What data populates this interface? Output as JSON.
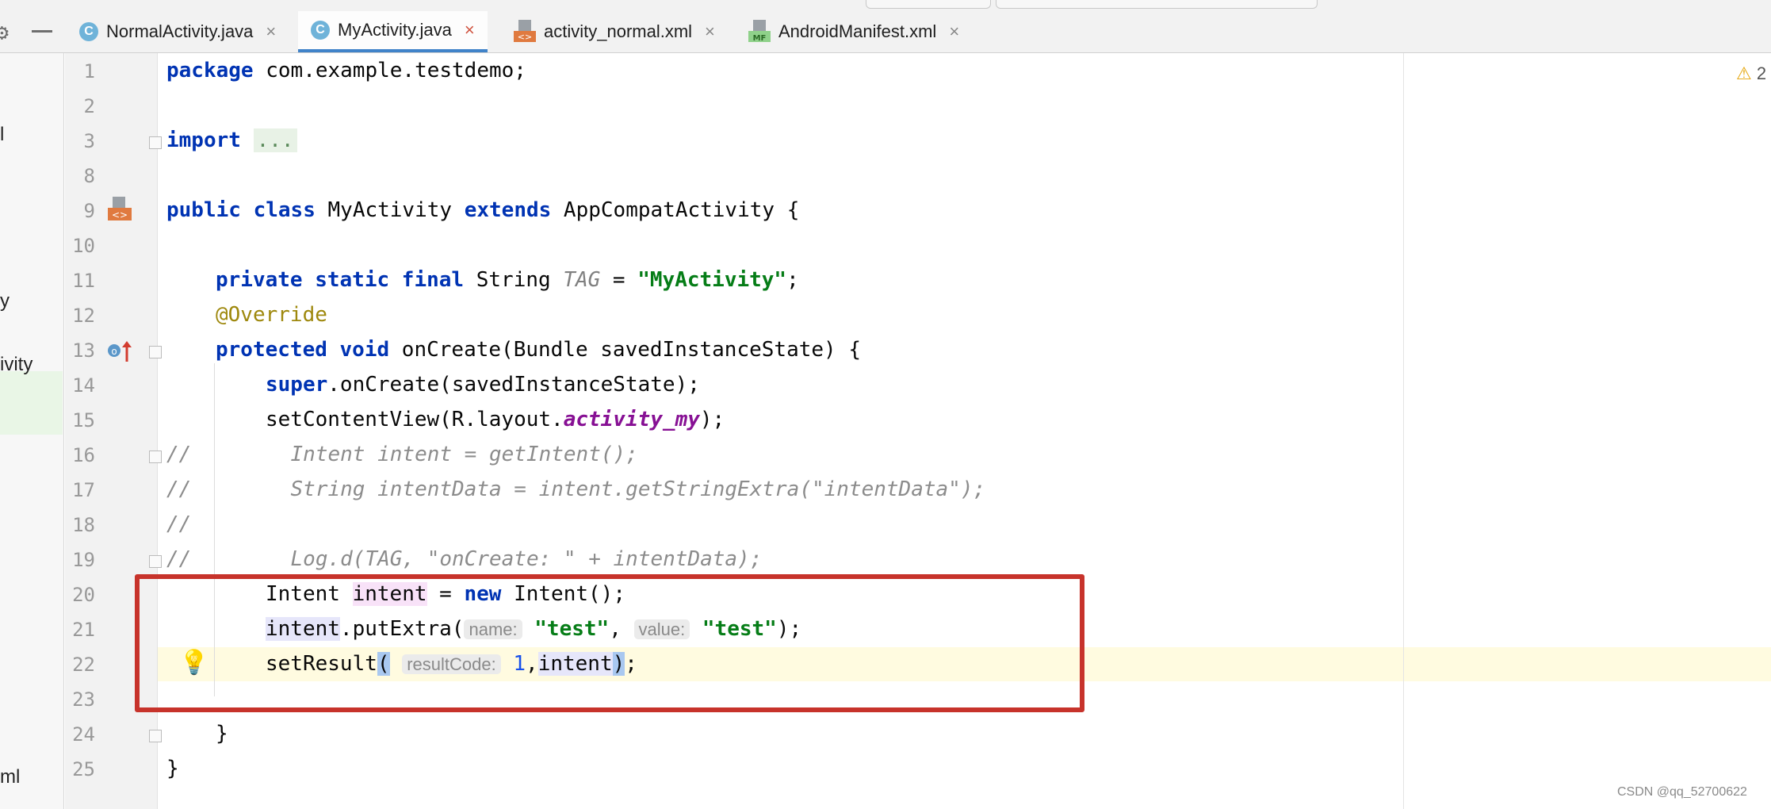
{
  "tabs": [
    {
      "label": "NormalActivity.java",
      "icon": "java-class-icon",
      "active": false
    },
    {
      "label": "MyActivity.java",
      "icon": "java-class-icon",
      "active": true
    },
    {
      "label": "activity_normal.xml",
      "icon": "layout-xml-icon",
      "active": false
    },
    {
      "label": "AndroidManifest.xml",
      "icon": "manifest-icon",
      "active": false
    }
  ],
  "sidebar_fragments": [
    "l",
    "y",
    "ivity",
    "ml"
  ],
  "warnings": {
    "count": "2"
  },
  "line_numbers": [
    "1",
    "2",
    "3",
    "8",
    "9",
    "10",
    "11",
    "12",
    "13",
    "14",
    "15",
    "16",
    "17",
    "18",
    "19",
    "20",
    "21",
    "22",
    "23",
    "24",
    "25"
  ],
  "code": {
    "l1_kw": "package",
    "l1_rest": " com.example.testdemo;",
    "l3_kw": "import",
    "l3_folded": "...",
    "l9_kw1": "public",
    "l9_kw2": "class",
    "l9_name": " MyActivity ",
    "l9_kw3": "extends",
    "l9_rest": " AppCompatActivity {",
    "l11_kw": "private static final",
    "l11_type": " String ",
    "l11_const": "TAG",
    "l11_eq": " = ",
    "l11_str": "\"MyActivity\"",
    "l11_end": ";",
    "l12_ann": "@Override",
    "l13_kw": "protected void",
    "l13_rest": " onCreate(Bundle savedInstanceState) {",
    "l14_kw": "super",
    "l14_rest": ".onCreate(savedInstanceState);",
    "l15_pre": "setContentView(R.layout.",
    "l15_field": "activity_my",
    "l15_end": ");",
    "l16": "//        Intent intent = getIntent();",
    "l17": "//        String intentData = intent.getStringExtra(\"intentData\");",
    "l18": "//",
    "l19": "//        Log.d(TAG, \"onCreate: \" + intentData);",
    "l20_pre": "Intent ",
    "l20_var": "intent",
    "l20_mid": " = ",
    "l20_kw": "new",
    "l20_end": " Intent();",
    "l21_var": "intent",
    "l21_call": ".putExtra(",
    "l21_hint1": "name:",
    "l21_str1": "\"test\"",
    "l21_comma": ", ",
    "l21_hint2": "value:",
    "l21_str2": "\"test\"",
    "l21_end": ");",
    "l22_pre": "setResult",
    "l22_paren": "(",
    "l22_hint": "resultCode:",
    "l22_num": "1",
    "l22_comma": ",",
    "l22_var": "intent",
    "l22_paren2": ")",
    "l22_end": ";",
    "l24": "}",
    "l25": "}"
  },
  "watermark": "CSDN @qq_52700622",
  "colors": {
    "keyword": "#0033b3",
    "string": "#067d17",
    "comment": "#8c8c8c",
    "annotation": "#9e880d",
    "highlight_box": "#c7332b",
    "tab_underline": "#4083c9"
  }
}
